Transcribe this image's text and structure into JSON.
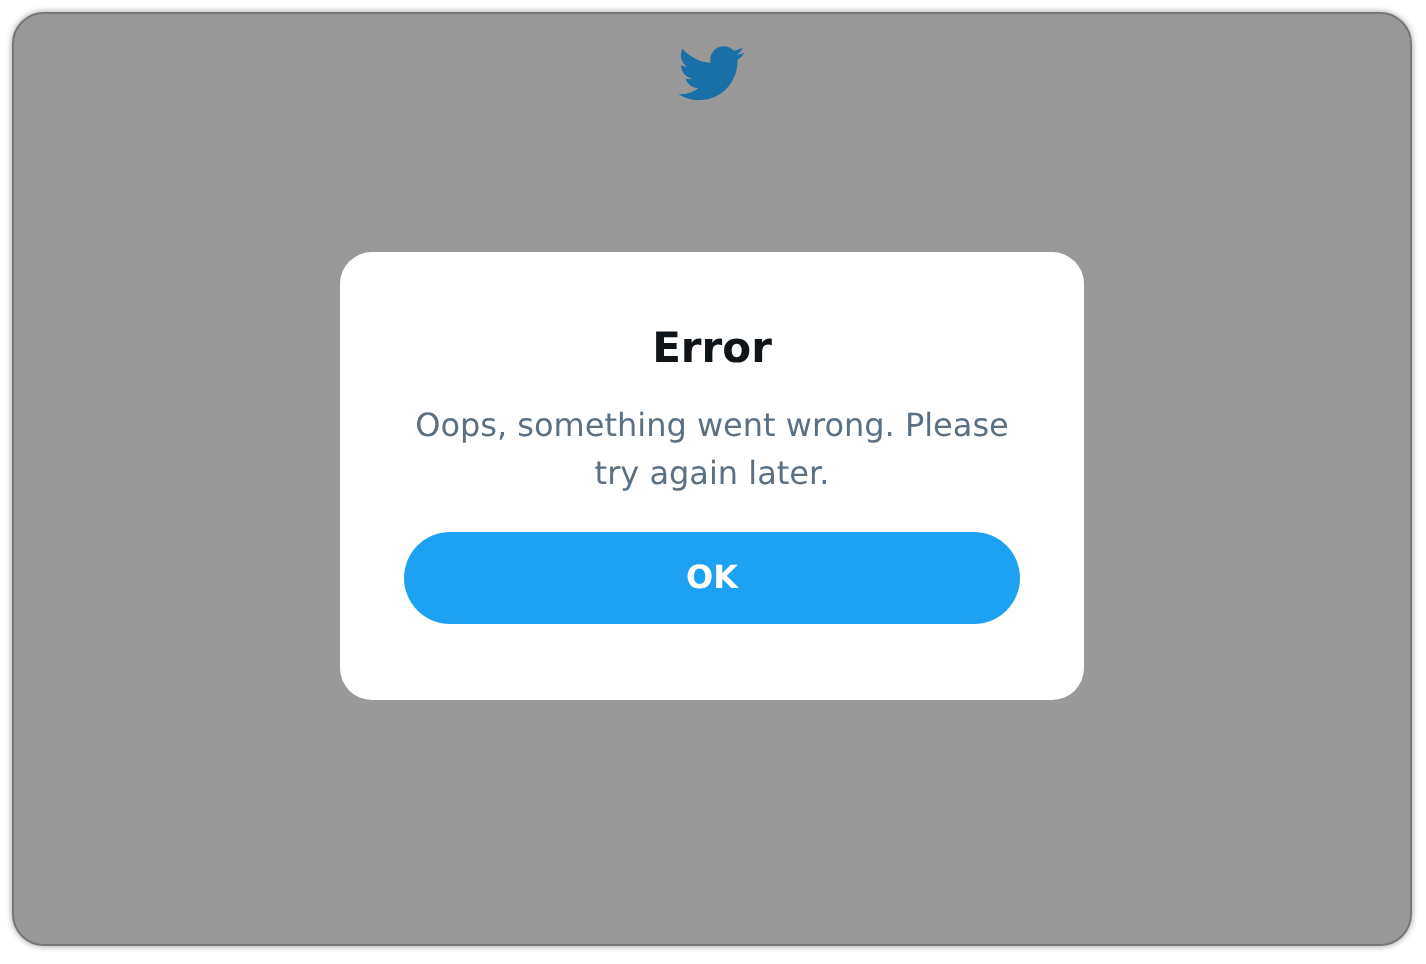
{
  "dialog": {
    "title": "Error",
    "message": "Oops, something went wrong. Please try again later.",
    "buttons": [
      "OK"
    ]
  }
}
